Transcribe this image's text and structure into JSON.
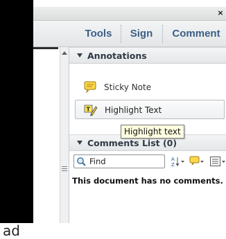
{
  "window": {
    "close_label": "×"
  },
  "toolbar": {
    "tabs": [
      {
        "label": "Tools"
      },
      {
        "label": "Sign"
      },
      {
        "label": "Comment"
      }
    ]
  },
  "annotations": {
    "title": "Annotations",
    "tools": [
      {
        "label": "Sticky Note",
        "icon": "sticky-note-icon"
      },
      {
        "label": "Highlight Text",
        "icon": "highlight-text-icon"
      }
    ],
    "tooltip": "Highlight text"
  },
  "comments_list": {
    "title": "Comments List (0)",
    "find_label": "Find",
    "empty_message": "This document has no comments."
  },
  "background": {
    "partial_text": "ad"
  },
  "colors": {
    "tab_text": "#3a5f86",
    "tooltip_bg": "#ffffe1"
  }
}
